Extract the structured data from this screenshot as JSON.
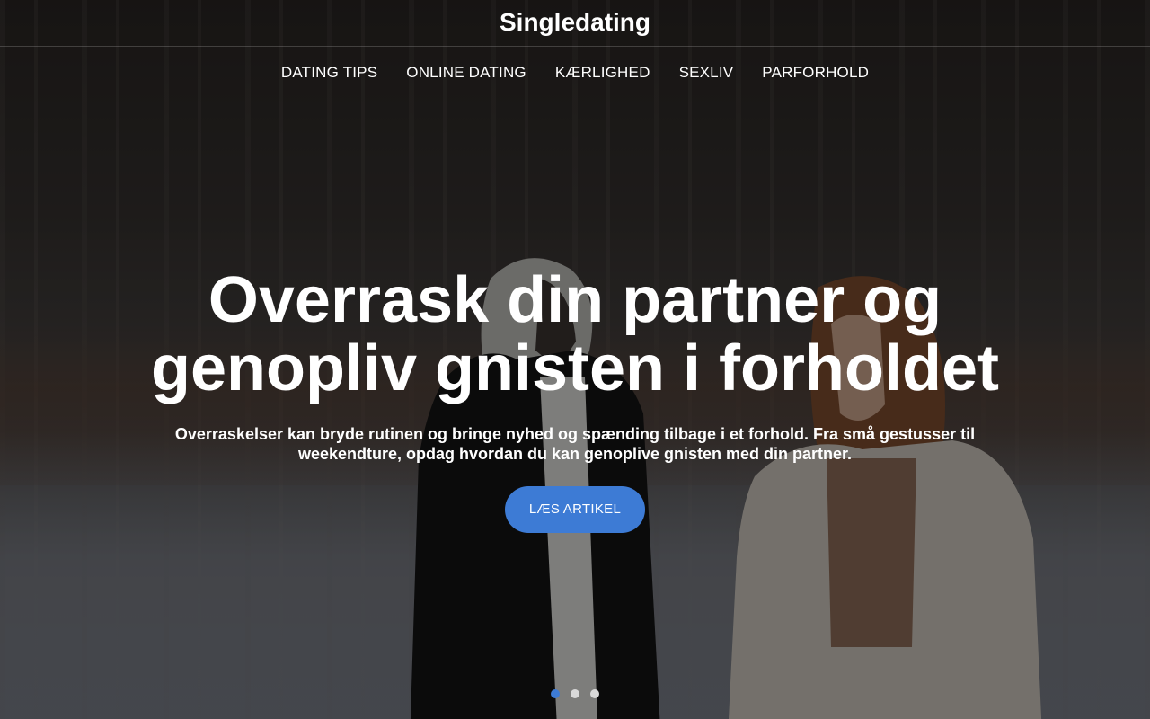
{
  "site": {
    "title": "Singledating"
  },
  "nav": {
    "items": [
      {
        "label": "DATING TIPS"
      },
      {
        "label": "ONLINE DATING"
      },
      {
        "label": "KÆRLIGHED"
      },
      {
        "label": "SEXLIV"
      },
      {
        "label": "PARFORHOLD"
      }
    ]
  },
  "hero": {
    "title_line1": "Overrask din partner og",
    "title_line2": "genopliv gnisten i forholdet",
    "text_line1": "Overraskelser kan bryde rutinen og bringe nyhed og spænding tilbage i et forhold. Fra små gestusser til",
    "text_line2": "weekendture, opdag hvordan du kan genoplive gnisten med din partner.",
    "button_label": "LÆS ARTIKEL"
  },
  "slider": {
    "slide_count": 3,
    "active_index": 0
  },
  "colors": {
    "accent": "#3d7bd5",
    "dot_inactive": "#d9d9d9",
    "text": "#ffffff"
  }
}
